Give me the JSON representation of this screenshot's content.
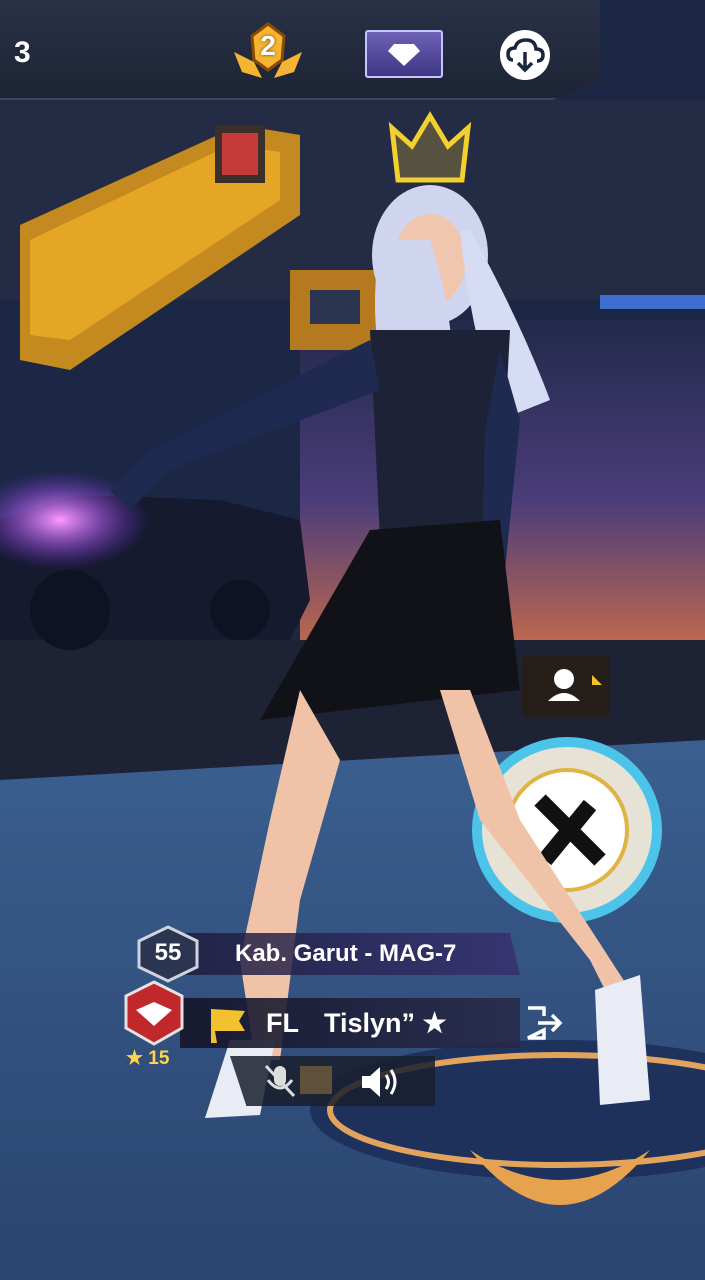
{
  "top_bar": {
    "counter": "3",
    "rank_badge_number": "2",
    "icons": {
      "rank": "rank-wings-icon",
      "diamond": "diamond-icon",
      "download": "cloud-download-icon"
    }
  },
  "player": {
    "level": "55",
    "location": "Kab. Garut - MAG-7",
    "clan_tag": "FL",
    "name": "Tislyn” ★",
    "rank_stars": "★ 15",
    "icons": {
      "crown": "crown-icon",
      "flag": "flag-icon",
      "exit": "exit-icon",
      "mic": "mic-muted-icon",
      "speaker": "speaker-icon",
      "task": "task-icon"
    }
  },
  "colors": {
    "accent_gold": "#f2c12e",
    "diamond_purple": "#5a4fb0",
    "rank_red": "#c0282c"
  }
}
